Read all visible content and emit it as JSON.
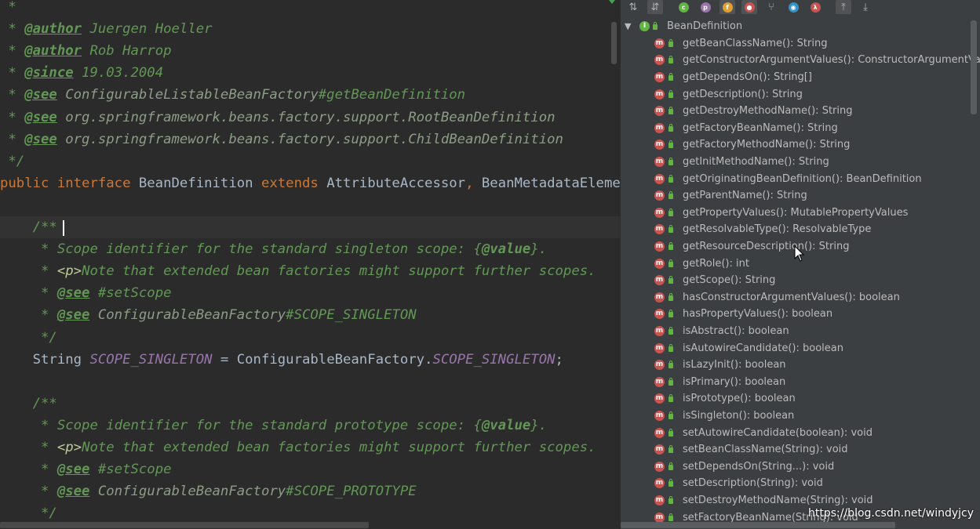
{
  "editor": {
    "lines": [
      {
        "segments": [
          {
            "c": "cm",
            "t": " *"
          }
        ]
      },
      {
        "segments": [
          {
            "c": "cm",
            "t": " * "
          },
          {
            "c": "tag",
            "t": "@author"
          },
          {
            "c": "cm",
            "t": " Juergen Hoeller"
          }
        ]
      },
      {
        "segments": [
          {
            "c": "cm",
            "t": " * "
          },
          {
            "c": "tag",
            "t": "@author"
          },
          {
            "c": "cm",
            "t": " Rob Harrop"
          }
        ]
      },
      {
        "segments": [
          {
            "c": "cm",
            "t": " * "
          },
          {
            "c": "tag",
            "t": "@since"
          },
          {
            "c": "cm",
            "t": " 19.03.2004"
          }
        ]
      },
      {
        "segments": [
          {
            "c": "cm",
            "t": " * "
          },
          {
            "c": "tag",
            "t": "@see"
          },
          {
            "c": "ref",
            "t": " ConfigurableListableBeanFactory"
          },
          {
            "c": "cm",
            "t": "#getBeanDefinition"
          }
        ]
      },
      {
        "segments": [
          {
            "c": "cm",
            "t": " * "
          },
          {
            "c": "tag",
            "t": "@see"
          },
          {
            "c": "ref",
            "t": " org.springframework.beans.factory.support.RootBeanDefinition"
          }
        ]
      },
      {
        "segments": [
          {
            "c": "cm",
            "t": " * "
          },
          {
            "c": "tag",
            "t": "@see"
          },
          {
            "c": "ref",
            "t": " org.springframework.beans.factory.support.ChildBeanDefinition"
          }
        ]
      },
      {
        "segments": [
          {
            "c": "cm",
            "t": " */"
          }
        ]
      },
      {
        "segments": [
          {
            "c": "kw",
            "t": "public interface "
          },
          {
            "c": "typ",
            "t": "BeanDefinition "
          },
          {
            "c": "kw",
            "t": "extends "
          },
          {
            "c": "typ",
            "t": "AttributeAccessor"
          },
          {
            "c": "kw",
            "t": ", "
          },
          {
            "c": "typ",
            "t": "BeanMetadataElement {"
          }
        ]
      },
      {
        "segments": []
      },
      {
        "segments": [
          {
            "c": "cm",
            "t": "    /**"
          }
        ]
      },
      {
        "segments": [
          {
            "c": "cm",
            "t": "     * Scope identifier for the standard singleton scope: {"
          },
          {
            "c": "vtag",
            "t": "@value"
          },
          {
            "c": "cm",
            "t": "}."
          }
        ]
      },
      {
        "segments": [
          {
            "c": "cm",
            "t": "     * "
          },
          {
            "c": "hl",
            "t": "<p>"
          },
          {
            "c": "cm",
            "t": "Note that extended bean factories might support further scopes."
          }
        ]
      },
      {
        "segments": [
          {
            "c": "cm",
            "t": "     * "
          },
          {
            "c": "tag",
            "t": "@see"
          },
          {
            "c": "cm",
            "t": " #setScope"
          }
        ]
      },
      {
        "segments": [
          {
            "c": "cm",
            "t": "     * "
          },
          {
            "c": "tag",
            "t": "@see"
          },
          {
            "c": "ref",
            "t": " ConfigurableBeanFactory"
          },
          {
            "c": "cm",
            "t": "#SCOPE_SINGLETON"
          }
        ]
      },
      {
        "segments": [
          {
            "c": "cm",
            "t": "     */"
          }
        ]
      },
      {
        "segments": [
          {
            "c": "txt",
            "t": "    String "
          },
          {
            "c": "fld",
            "t": "SCOPE_SINGLETON"
          },
          {
            "c": "txt",
            "t": " = ConfigurableBeanFactory."
          },
          {
            "c": "fld",
            "t": "SCOPE_SINGLETON"
          },
          {
            "c": "txt",
            "t": ";"
          }
        ]
      },
      {
        "segments": []
      },
      {
        "segments": [
          {
            "c": "cm",
            "t": "    /**"
          }
        ]
      },
      {
        "segments": [
          {
            "c": "cm",
            "t": "     * Scope identifier for the standard prototype scope: {"
          },
          {
            "c": "vtag",
            "t": "@value"
          },
          {
            "c": "cm",
            "t": "}."
          }
        ]
      },
      {
        "segments": [
          {
            "c": "cm",
            "t": "     * "
          },
          {
            "c": "hl",
            "t": "<p>"
          },
          {
            "c": "cm",
            "t": "Note that extended bean factories might support further scopes."
          }
        ]
      },
      {
        "segments": [
          {
            "c": "cm",
            "t": "     * "
          },
          {
            "c": "tag",
            "t": "@see"
          },
          {
            "c": "cm",
            "t": " #setScope"
          }
        ]
      },
      {
        "segments": [
          {
            "c": "cm",
            "t": "     * "
          },
          {
            "c": "tag",
            "t": "@see"
          },
          {
            "c": "ref",
            "t": " ConfigurableBeanFactory"
          },
          {
            "c": "cm",
            "t": "#SCOPE_PROTOTYPE"
          }
        ]
      },
      {
        "segments": [
          {
            "c": "cm",
            "t": "     */"
          }
        ]
      }
    ]
  },
  "structure": {
    "toolbar": [
      {
        "name": "sort-by-visibility-icon",
        "glyph": "⇅",
        "on": false
      },
      {
        "name": "sort-alphabetically-icon",
        "glyph": "⇵",
        "on": true
      },
      {
        "name": "show-classes-icon",
        "glyph": "c",
        "color": "#62b543",
        "on": false
      },
      {
        "name": "show-properties-icon",
        "glyph": "p",
        "color": "#9876aa",
        "on": false
      },
      {
        "name": "show-fields-icon",
        "glyph": "f",
        "color": "#e0a030",
        "on": true
      },
      {
        "name": "show-non-public-icon",
        "glyph": "●",
        "color": "#c75450",
        "on": true
      },
      {
        "name": "show-inherited-icon",
        "glyph": "⑂",
        "on": false
      },
      {
        "name": "show-anonymous-icon",
        "glyph": "◉",
        "color": "#3592c4",
        "on": false
      },
      {
        "name": "show-lambdas-icon",
        "glyph": "λ",
        "color": "#c75450",
        "on": false
      },
      {
        "name": "autoscroll-to-source-icon",
        "glyph": "⤒",
        "on": true
      },
      {
        "name": "autoscroll-from-source-icon",
        "glyph": "⤓",
        "on": false
      }
    ],
    "root": {
      "label": "BeanDefinition",
      "icon": "I"
    },
    "methods": [
      "getBeanClassName(): String",
      "getConstructorArgumentValues(): ConstructorArgumentValues",
      "getDependsOn(): String[]",
      "getDescription(): String",
      "getDestroyMethodName(): String",
      "getFactoryBeanName(): String",
      "getFactoryMethodName(): String",
      "getInitMethodName(): String",
      "getOriginatingBeanDefinition(): BeanDefinition",
      "getParentName(): String",
      "getPropertyValues(): MutablePropertyValues",
      "getResolvableType(): ResolvableType",
      "getResourceDescription(): String",
      "getRole(): int",
      "getScope(): String",
      "hasConstructorArgumentValues(): boolean",
      "hasPropertyValues(): boolean",
      "isAbstract(): boolean",
      "isAutowireCandidate(): boolean",
      "isLazyInit(): boolean",
      "isPrimary(): boolean",
      "isPrototype(): boolean",
      "isSingleton(): boolean",
      "setAutowireCandidate(boolean): void",
      "setBeanClassName(String): void",
      "setDependsOn(String...): void",
      "setDescription(String): void",
      "setDestroyMethodName(String): void",
      "setFactoryBeanName(String): void"
    ],
    "method_icon": "m"
  },
  "watermark": "https://blog.csdn.net/windyjcy"
}
